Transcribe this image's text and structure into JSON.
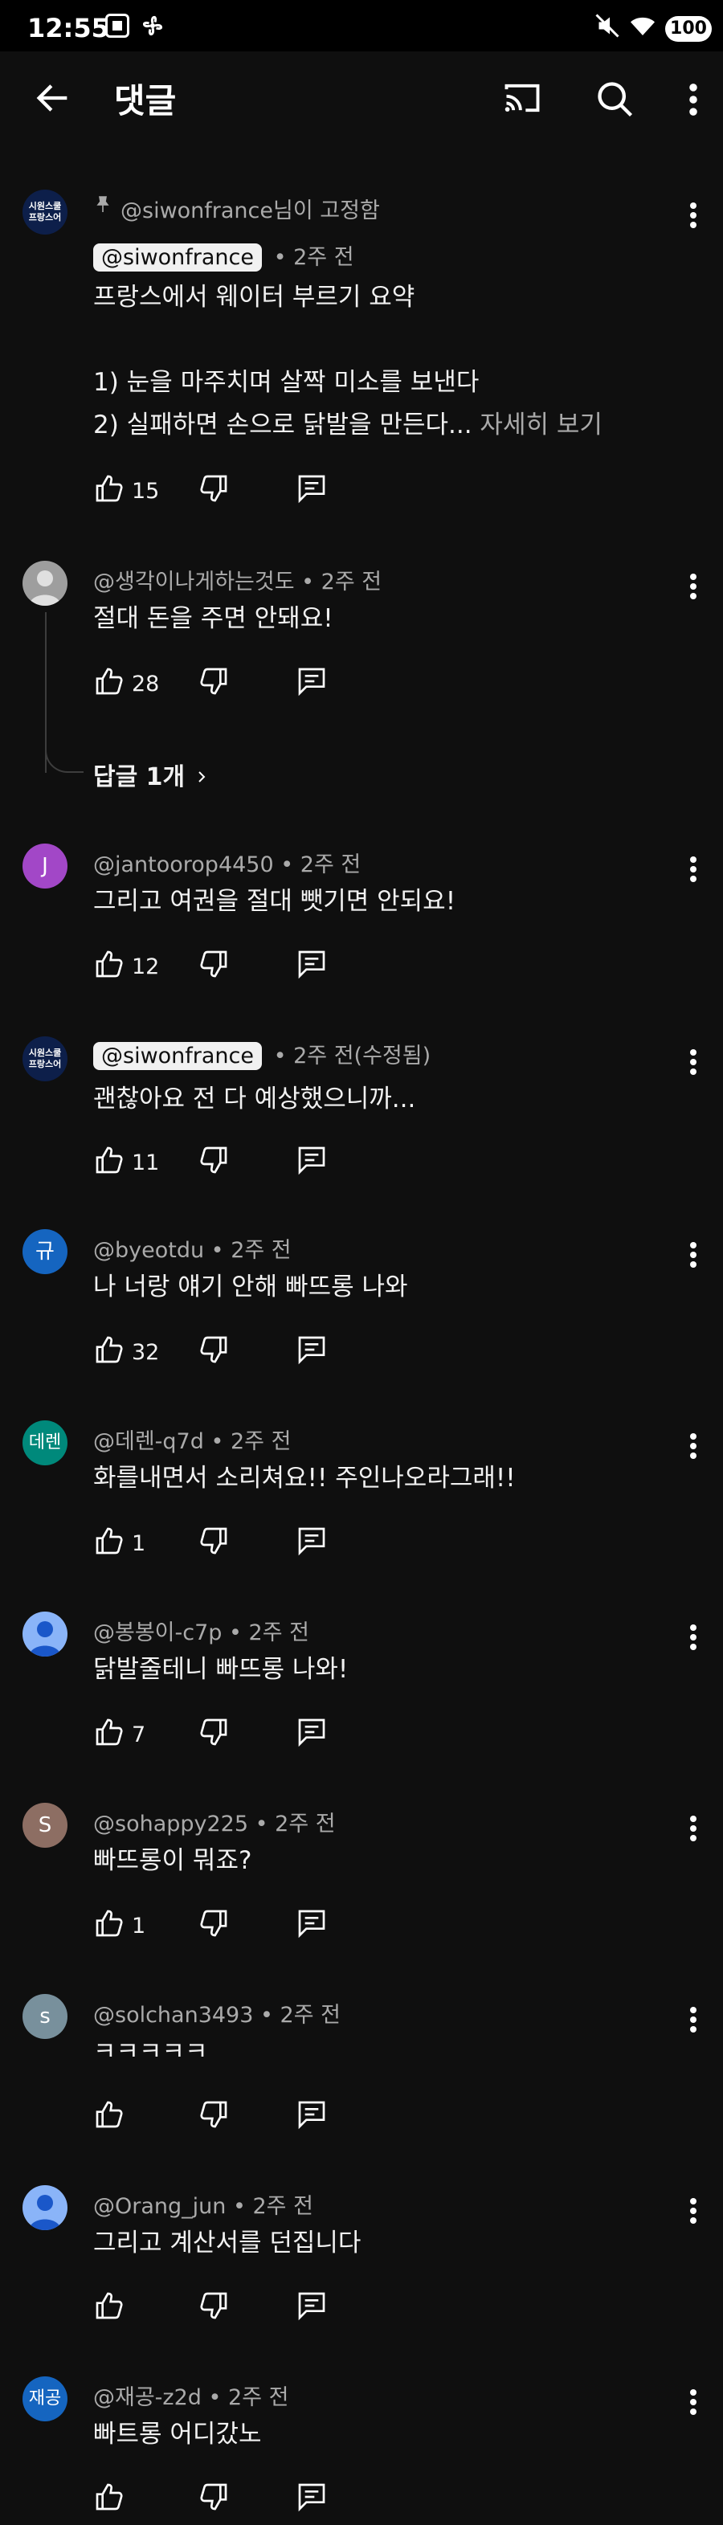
{
  "status_bar": {
    "time": "12:55",
    "battery": "100"
  },
  "header": {
    "title": "댓글"
  },
  "pinned": {
    "label": "@siwonfrance님이 고정함"
  },
  "comments": [
    {
      "handle": "@siwonfrance",
      "time": "2주 전",
      "text": "프랑스에서 웨이터 부르기 요약\n\n1) 눈을 마주치며 살짝 미소를 보낸다\n2) 실패하면 손으로 닭발을 만든다...",
      "more": "자세히 보기",
      "likes": "15"
    },
    {
      "handle": "@생각이나게하는것도",
      "time": "2주 전",
      "text": "절대 돈을 주면 안돼요!",
      "likes": "28",
      "replies": "답글 1개"
    },
    {
      "handle": "@jantoorop4450",
      "time": "2주 전",
      "text": "그리고 여권을 절대 뺏기면 안되요!",
      "likes": "12",
      "avatar_letter": "J"
    },
    {
      "handle": "@siwonfrance",
      "time": "2주 전(수정됨)",
      "text": "괜찮아요 전 다 예상했으니까...",
      "likes": "11"
    },
    {
      "handle": "@byeotdu",
      "time": "2주 전",
      "text": "나 너랑 얘기 안해 빠뜨롱 나와",
      "likes": "32",
      "avatar_letter": "규"
    },
    {
      "handle": "@데렌-q7d",
      "time": "2주 전",
      "text": "화를내면서 소리쳐요!! 주인나오라그래!!",
      "likes": "1",
      "avatar_letter": "데렌"
    },
    {
      "handle": "@봉봉이-c7p",
      "time": "2주 전",
      "text": "닭발줄테니 빠뜨롱 나와!",
      "likes": "7"
    },
    {
      "handle": "@sohappy225",
      "time": "2주 전",
      "text": "빠뜨롱이 뭐죠?",
      "likes": "1",
      "avatar_letter": "S"
    },
    {
      "handle": "@solchan3493",
      "time": "2주 전",
      "text": "ㅋㅋㅋㅋㅋ",
      "likes": "",
      "avatar_letter": "s"
    },
    {
      "handle": "@Orang_jun",
      "time": "2주 전",
      "text": "그리고 계산서를 던집니다",
      "likes": ""
    },
    {
      "handle": "@재공-z2d",
      "time": "2주 전",
      "text": "빠트롱 어디갔노",
      "likes": "",
      "avatar_letter": "재공"
    }
  ],
  "channel_avatar_text": "시원스쿨\n프랑스어",
  "colors": {
    "background": "#0f0f0f",
    "text": "#f1f1f1",
    "secondary": "#aaaaaa",
    "avatar_purple": "#a247c7",
    "avatar_blue": "#1565c0",
    "avatar_teal": "#00897b",
    "avatar_brown": "#8d6e63",
    "avatar_gray": "#78909c"
  }
}
